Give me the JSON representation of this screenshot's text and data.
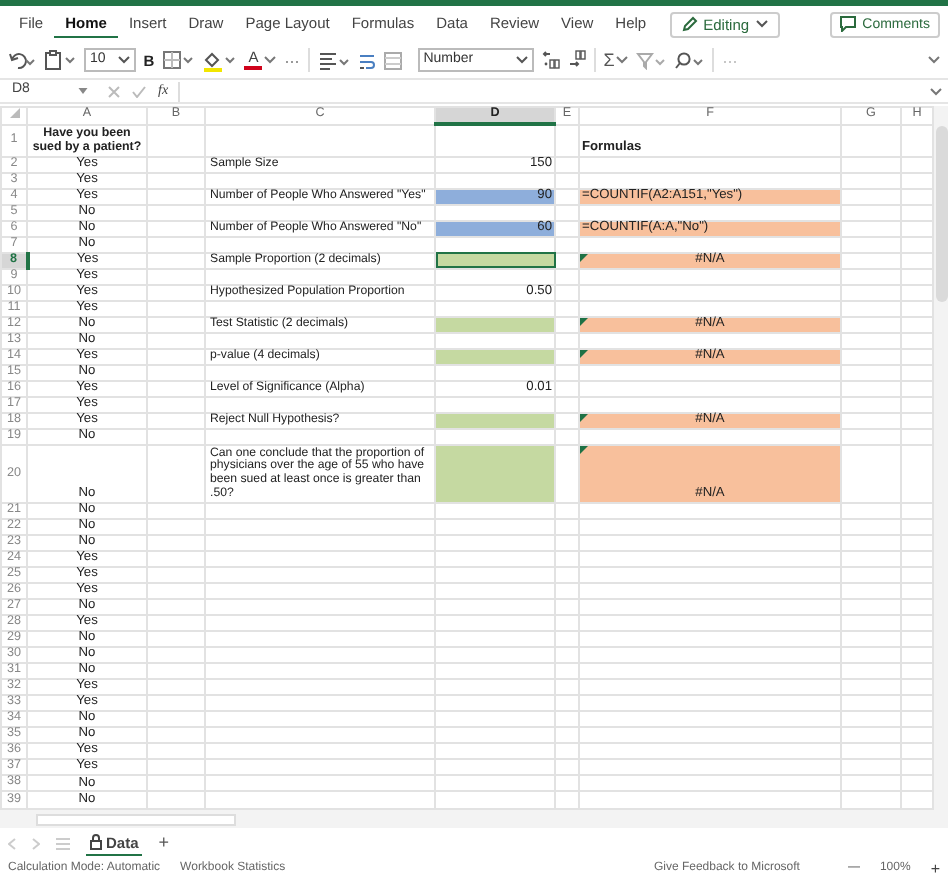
{
  "ribbon_tabs": [
    {
      "label": "File",
      "selected": false
    },
    {
      "label": "Home",
      "selected": true
    },
    {
      "label": "Insert",
      "selected": false
    },
    {
      "label": "Draw",
      "selected": false
    },
    {
      "label": "Page Layout",
      "selected": false
    },
    {
      "label": "Formulas",
      "selected": false
    },
    {
      "label": "Data",
      "selected": false
    },
    {
      "label": "Review",
      "selected": false
    },
    {
      "label": "View",
      "selected": false
    },
    {
      "label": "Help",
      "selected": false
    }
  ],
  "editing_button": {
    "label": "Editing"
  },
  "comments_button": {
    "label": "Comments"
  },
  "toolbar": {
    "font_size": "10",
    "bold": "B",
    "font_color": "A",
    "more": "···",
    "number_format": "Number",
    "sum": "Σ",
    "more_end": "···"
  },
  "formula_bar": {
    "name_box": "D8",
    "function_label": "fx"
  },
  "columns": [
    {
      "label": "A",
      "selected": false
    },
    {
      "label": "B",
      "selected": false
    },
    {
      "label": "C",
      "selected": false
    },
    {
      "label": "D",
      "selected": true
    },
    {
      "label": "E",
      "selected": false
    },
    {
      "label": "F",
      "selected": false
    },
    {
      "label": "G",
      "selected": false
    },
    {
      "label": "H",
      "selected": false
    }
  ],
  "rows": [
    {
      "number": "1",
      "selected": false,
      "a": {
        "text": "Have you been sued by a patient?",
        "kind": "header"
      },
      "f": {
        "text": "Formulas",
        "kind": "label"
      }
    },
    {
      "number": "2",
      "selected": false,
      "a": {
        "text": "Yes"
      },
      "c": {
        "text": "Sample Size"
      },
      "d": {
        "text": "150"
      }
    },
    {
      "number": "3",
      "selected": false,
      "a": {
        "text": "Yes"
      }
    },
    {
      "number": "4",
      "selected": false,
      "a": {
        "text": "Yes"
      },
      "c": {
        "text": "Number of People Who Answered \"Yes\""
      },
      "d": {
        "text": "90",
        "color": "#8eaedb"
      },
      "f": {
        "text": "=COUNTIF(A2:A151,\"Yes\")",
        "kind": "formula",
        "color": "#f8c09c"
      }
    },
    {
      "number": "5",
      "selected": false,
      "a": {
        "text": "No"
      }
    },
    {
      "number": "6",
      "selected": false,
      "a": {
        "text": "No"
      },
      "c": {
        "text": "Number of People Who Answered \"No\""
      },
      "d": {
        "text": "60",
        "color": "#8eaedb"
      },
      "f": {
        "text": "=COUNTIF(A:A,\"No\")",
        "kind": "formula",
        "color": "#f8c09c"
      }
    },
    {
      "number": "7",
      "selected": false,
      "a": {
        "text": "No"
      }
    },
    {
      "number": "8",
      "selected": true,
      "a": {
        "text": "Yes"
      },
      "c": {
        "text": "Sample Proportion (2 decimals)"
      },
      "d": {
        "color": "#c5d9a1"
      },
      "f": {
        "text": "#N/A",
        "kind": "error",
        "color": "#f8c09c"
      }
    },
    {
      "number": "9",
      "selected": false,
      "a": {
        "text": "Yes"
      }
    },
    {
      "number": "10",
      "selected": false,
      "a": {
        "text": "Yes"
      },
      "c": {
        "text": "Hypothesized Population Proportion"
      },
      "d": {
        "text": "0.50"
      }
    },
    {
      "number": "11",
      "selected": false,
      "a": {
        "text": "Yes"
      }
    },
    {
      "number": "12",
      "selected": false,
      "a": {
        "text": "No"
      },
      "c": {
        "text": "Test Statistic (2 decimals)"
      },
      "d": {
        "color": "#c5d9a1"
      },
      "f": {
        "text": "#N/A",
        "kind": "error",
        "color": "#f8c09c"
      }
    },
    {
      "number": "13",
      "selected": false,
      "a": {
        "text": "No"
      }
    },
    {
      "number": "14",
      "selected": false,
      "a": {
        "text": "Yes"
      },
      "c": {
        "text": "p-value (4 decimals)"
      },
      "d": {
        "color": "#c5d9a1"
      },
      "f": {
        "text": "#N/A",
        "kind": "error",
        "color": "#f8c09c"
      }
    },
    {
      "number": "15",
      "selected": false,
      "a": {
        "text": "No"
      }
    },
    {
      "number": "16",
      "selected": false,
      "a": {
        "text": "Yes"
      },
      "c": {
        "text": "Level of Significance (Alpha)"
      },
      "d": {
        "text": "0.01"
      }
    },
    {
      "number": "17",
      "selected": false,
      "a": {
        "text": "Yes"
      }
    },
    {
      "number": "18",
      "selected": false,
      "a": {
        "text": "Yes"
      },
      "c": {
        "text": "Reject Null Hypothesis?"
      },
      "d": {
        "color": "#c5d9a1"
      },
      "f": {
        "text": "#N/A",
        "kind": "error",
        "color": "#f8c09c"
      }
    },
    {
      "number": "19",
      "selected": false,
      "a": {
        "text": "No"
      }
    },
    {
      "number": "20",
      "selected": false,
      "a": {
        "text": "No"
      },
      "c": {
        "text": "Can one conclude that the proportion of physicians over the age of 55 who have been sued at least once is greater than .50?"
      },
      "d": {
        "color": "#c5d9a1"
      },
      "f": {
        "text": "#N/A",
        "kind": "error",
        "color": "#f8c09c"
      }
    },
    {
      "number": "21",
      "selected": false,
      "a": {
        "text": "No"
      }
    },
    {
      "number": "22",
      "selected": false,
      "a": {
        "text": "No"
      }
    },
    {
      "number": "23",
      "selected": false,
      "a": {
        "text": "No"
      }
    },
    {
      "number": "24",
      "selected": false,
      "a": {
        "text": "Yes"
      }
    },
    {
      "number": "25",
      "selected": false,
      "a": {
        "text": "Yes"
      }
    },
    {
      "number": "26",
      "selected": false,
      "a": {
        "text": "Yes"
      }
    },
    {
      "number": "27",
      "selected": false,
      "a": {
        "text": "No"
      }
    },
    {
      "number": "28",
      "selected": false,
      "a": {
        "text": "Yes"
      }
    },
    {
      "number": "29",
      "selected": false,
      "a": {
        "text": "No"
      }
    },
    {
      "number": "30",
      "selected": false,
      "a": {
        "text": "No"
      }
    },
    {
      "number": "31",
      "selected": false,
      "a": {
        "text": "No"
      }
    },
    {
      "number": "32",
      "selected": false,
      "a": {
        "text": "Yes"
      }
    },
    {
      "number": "33",
      "selected": false,
      "a": {
        "text": "Yes"
      }
    },
    {
      "number": "34",
      "selected": false,
      "a": {
        "text": "No"
      }
    },
    {
      "number": "35",
      "selected": false,
      "a": {
        "text": "No"
      }
    },
    {
      "number": "36",
      "selected": false,
      "a": {
        "text": "Yes"
      }
    },
    {
      "number": "37",
      "selected": false,
      "a": {
        "text": "Yes"
      }
    },
    {
      "number": "38",
      "selected": false,
      "a": {
        "text": "No"
      }
    },
    {
      "number": "39",
      "selected": false,
      "a": {
        "text": "No"
      }
    }
  ],
  "sheet_tabs": [
    {
      "label": "Data",
      "selected": true
    }
  ],
  "add_sheet": "+",
  "status_bar": {
    "calculation_mode": "Calculation Mode: Automatic",
    "workbook_statistics": "Workbook Statistics",
    "feedback": "Give Feedback to Microsoft",
    "zoom_out": "—",
    "zoom": "100%",
    "zoom_in": "+"
  }
}
